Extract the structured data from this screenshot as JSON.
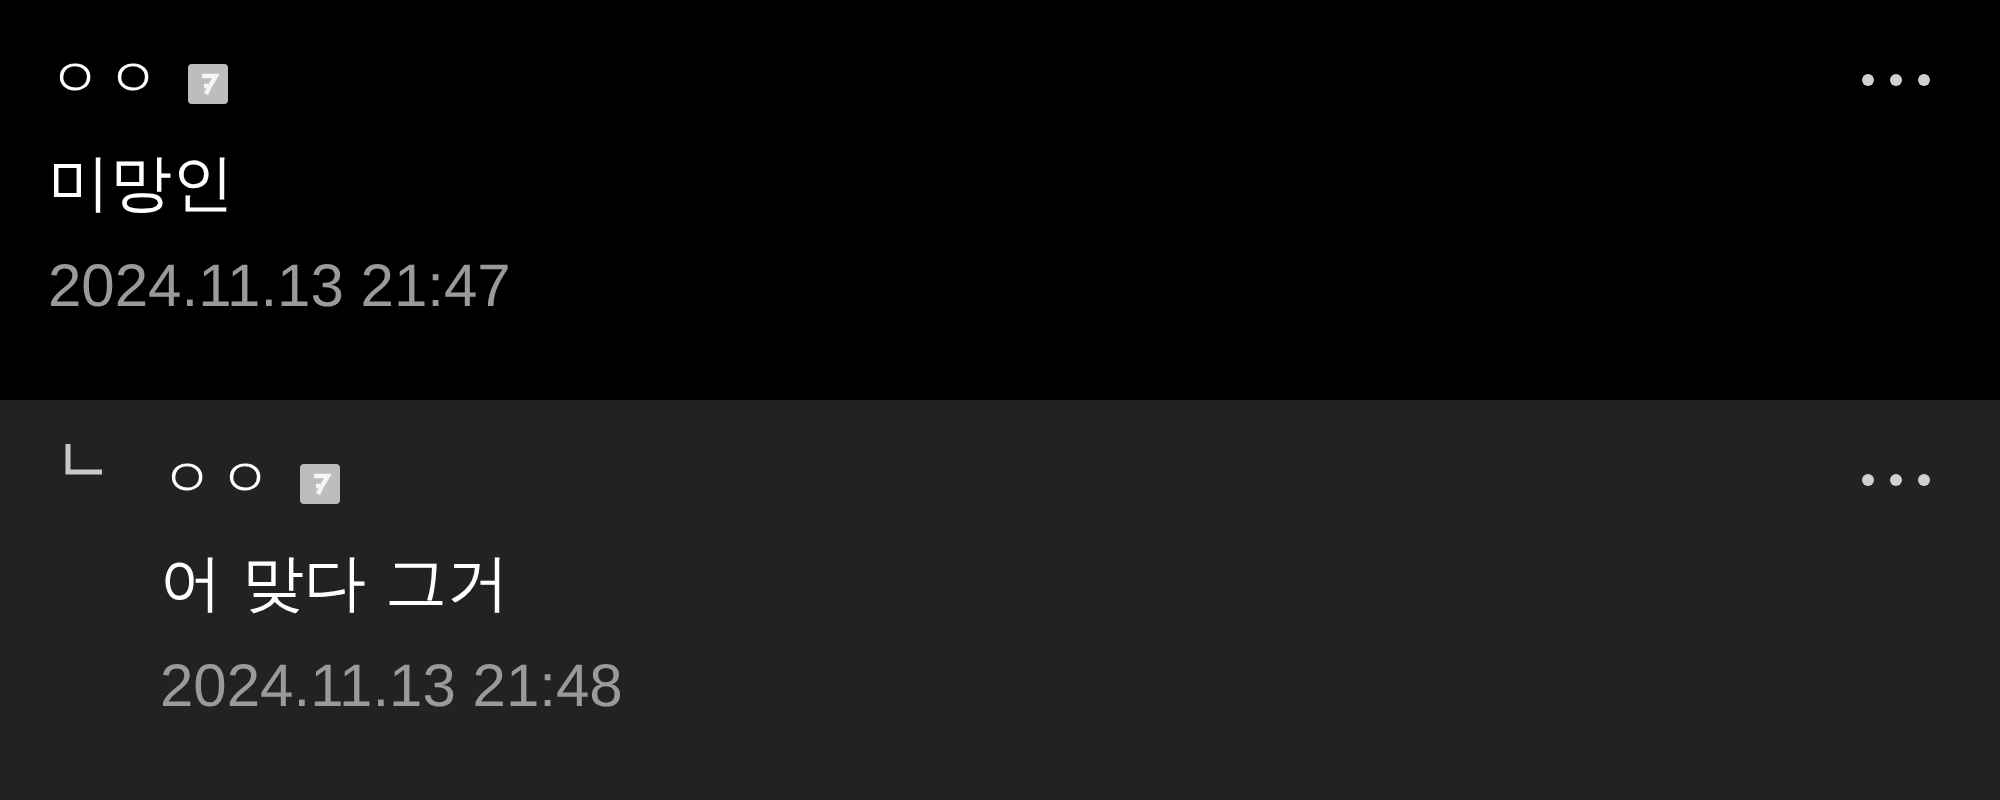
{
  "comments": [
    {
      "kind": "comment",
      "author": "ㅇㅇ",
      "text": "미망인",
      "time": "2024.11.13 21:47"
    },
    {
      "kind": "reply",
      "author": "ㅇㅇ",
      "text": "어 맞다 그거",
      "time": "2024.11.13 21:48"
    }
  ]
}
